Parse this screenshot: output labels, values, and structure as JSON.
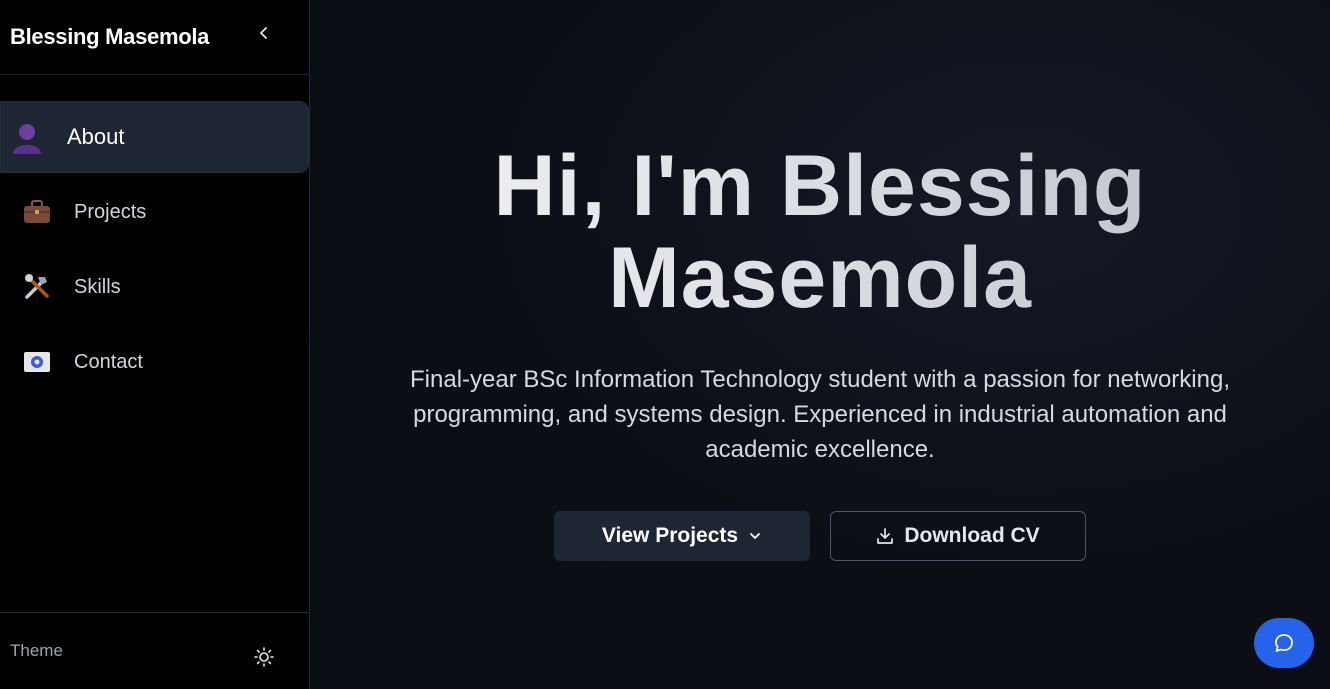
{
  "sidebar": {
    "brand": "Blessing Masemola",
    "nav": [
      {
        "label": "About",
        "icon": "person-icon",
        "active": true
      },
      {
        "label": "Projects",
        "icon": "briefcase-icon",
        "active": false
      },
      {
        "label": "Skills",
        "icon": "tools-icon",
        "active": false
      },
      {
        "label": "Contact",
        "icon": "email-icon",
        "active": false
      }
    ],
    "footer": {
      "theme_label": "Theme",
      "theme_icon": "sun-icon"
    }
  },
  "hero": {
    "title_line1": "Hi, I'm Blessing",
    "title_line2": "Masemola",
    "subtitle": "Final-year BSc Information Technology student with a passion for networking, programming, and systems design. Experienced in industrial automation and academic excellence.",
    "primary_button": "View Projects",
    "secondary_button": "Download CV"
  },
  "colors": {
    "accent_blue": "#2563eb",
    "active_nav_bg": "#1e2533"
  }
}
